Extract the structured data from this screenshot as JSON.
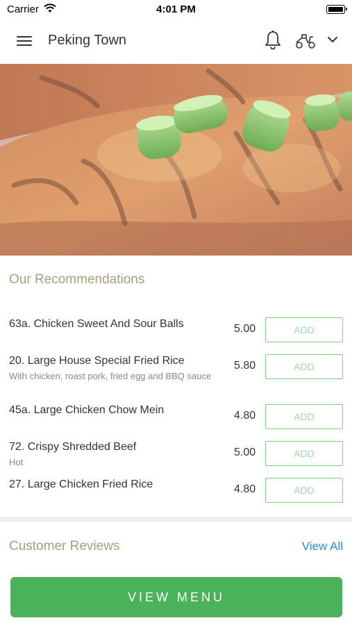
{
  "status_bar": {
    "carrier": "Carrier",
    "time": "4:01 PM"
  },
  "header": {
    "title": "Peking Town",
    "icons": {
      "menu": "hamburger-icon",
      "bell": "bell-icon",
      "delivery": "scooter-icon",
      "dropdown": "chevron-down-icon"
    }
  },
  "hero": {
    "image": "grilled chicken with spring onions"
  },
  "recommendations": {
    "title": "Our Recommendations",
    "add_label": "ADD",
    "items": [
      {
        "name": "63a. Chicken Sweet And Sour Balls",
        "desc": "",
        "price": "5.00"
      },
      {
        "name": "20. Large House Special Fried Rice",
        "desc": "With chicken, roast pork, fried egg and BBQ sauce",
        "price": "5.80"
      },
      {
        "name": "45a. Large Chicken Chow Mein",
        "desc": "",
        "price": "4.80"
      },
      {
        "name": "72. Crispy Shredded Beef",
        "desc": "Hot",
        "price": "5.00"
      },
      {
        "name": "27. Large Chicken Fried Rice",
        "desc": "",
        "price": "4.80"
      }
    ]
  },
  "reviews": {
    "title": "Customer Reviews",
    "view_all": "View All"
  },
  "cta": {
    "view_menu": "VIEW MENU"
  },
  "colors": {
    "accent_green": "#4cb25a",
    "section_title": "#a89e7d",
    "link_blue": "#2a8fc0"
  }
}
